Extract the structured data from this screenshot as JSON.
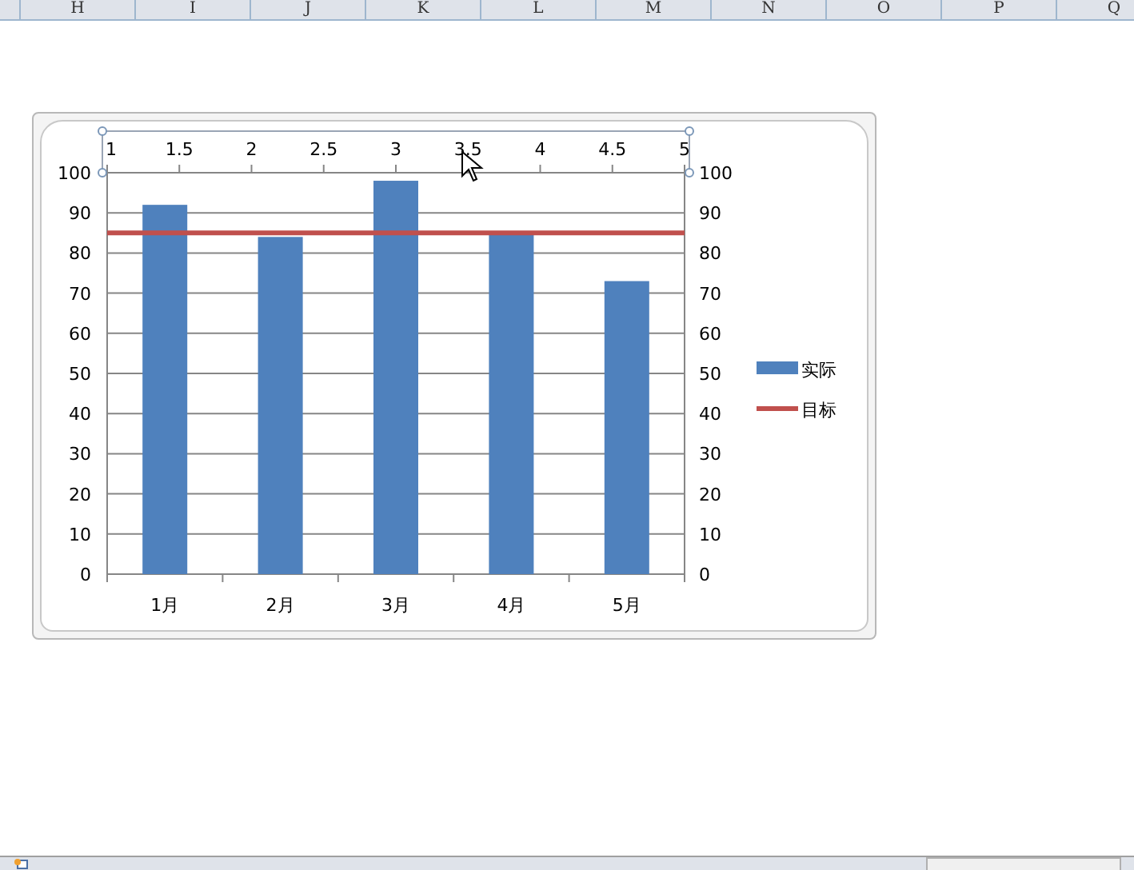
{
  "columns": [
    "H",
    "I",
    "J",
    "K",
    "L",
    "M",
    "N",
    "O",
    "P",
    "Q"
  ],
  "chart": {
    "chart_data": {
      "type": "bar",
      "categories": [
        "1月",
        "2月",
        "3月",
        "4月",
        "5月"
      ],
      "series": [
        {
          "name": "实际",
          "color": "#4f81bd",
          "values": [
            92,
            84,
            98,
            85,
            73
          ]
        }
      ],
      "ref_lines": [
        {
          "label": "目标",
          "axis": "y",
          "value": 85,
          "color": "#c0504d"
        }
      ],
      "grid": true,
      "legend": "right",
      "ylim": [
        0,
        100
      ],
      "yticks": [
        0,
        10,
        20,
        30,
        40,
        50,
        60,
        70,
        80,
        90,
        100
      ],
      "y2lim": [
        0,
        100
      ],
      "y2ticks": [
        0,
        10,
        20,
        30,
        40,
        50,
        60,
        70,
        80,
        90,
        100
      ],
      "x2ticks": [
        1,
        1.5,
        2,
        2.5,
        3,
        3.5,
        4,
        4.5,
        5
      ],
      "x2lim": [
        1,
        5
      ]
    }
  }
}
